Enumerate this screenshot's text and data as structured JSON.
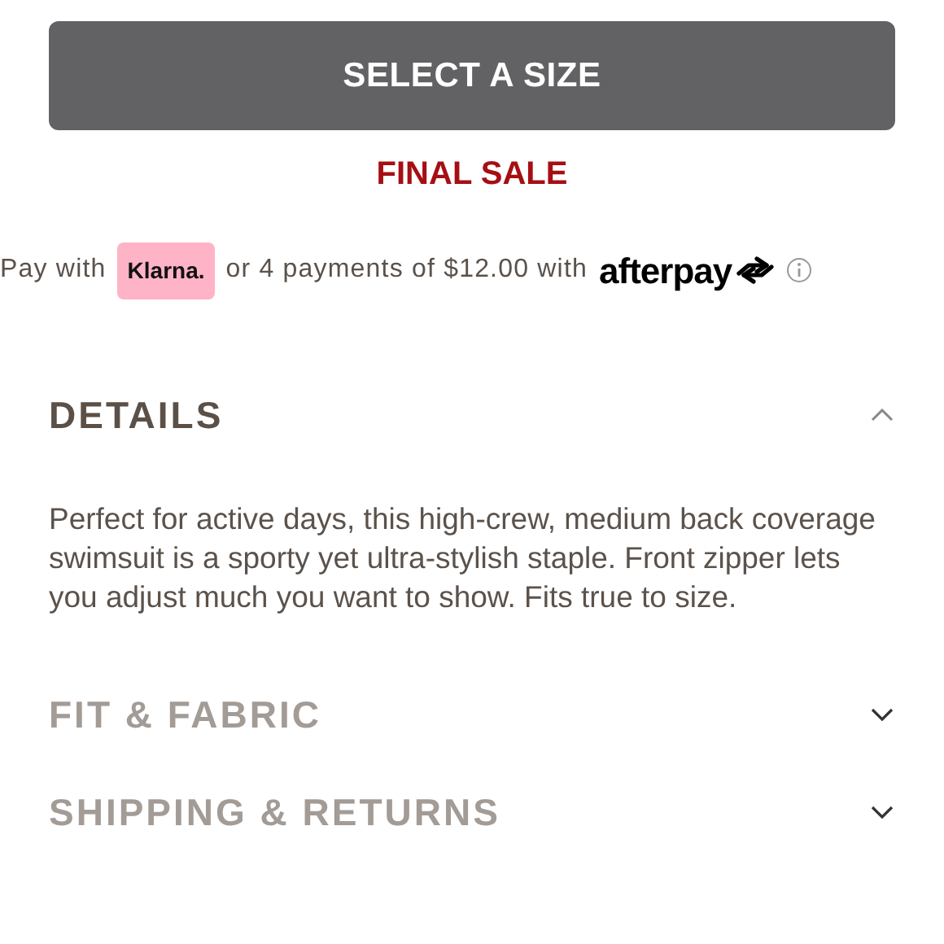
{
  "size_button": {
    "label": "SELECT A SIZE",
    "disabled": true
  },
  "final_sale": "FINAL SALE",
  "payment": {
    "pay_with": "Pay with",
    "klarna": "Klarna.",
    "installments": "or 4 payments of $12.00 with",
    "afterpay": "afterpay"
  },
  "sections": [
    {
      "title": "DETAILS",
      "expanded": true,
      "body": "Perfect for active days, this high-crew, medium back coverage swimsuit is a sporty yet ultra-stylish staple. Front zipper lets you adjust much you want to show. Fits true to size."
    },
    {
      "title": "FIT & FABRIC",
      "expanded": false
    },
    {
      "title": "SHIPPING & RETURNS",
      "expanded": false
    }
  ]
}
